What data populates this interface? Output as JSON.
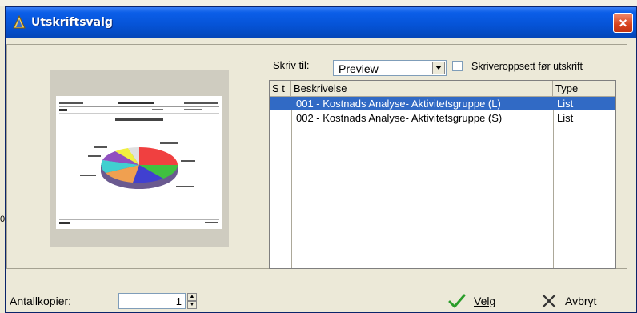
{
  "window": {
    "title": "Utskriftsvalg",
    "close_label": "×"
  },
  "background": {
    "stray_text": "0"
  },
  "print_to": {
    "label": "Skriv til:",
    "selected": "Preview"
  },
  "printer_setup": {
    "label": "Skriveroppsett før utskrift",
    "checked": false
  },
  "report_list": {
    "columns": [
      "S t",
      "Beskrivelse",
      "Type"
    ],
    "rows": [
      {
        "status": "",
        "description": "001 - Kostnads Analyse- Aktivitetsgruppe (L)",
        "type": "List",
        "selected": true
      },
      {
        "status": "",
        "description": "002 - Kostnads Analyse- Aktivitetsgruppe (S)",
        "type": "List",
        "selected": false
      }
    ]
  },
  "copies": {
    "label": "Antallkopier:",
    "value": "1"
  },
  "actions": {
    "select_label": "Velg",
    "cancel_label": "Avbryt"
  },
  "colors": {
    "titlebar": "#0553d6",
    "selection": "#316ac5",
    "select_icon": "#2a9d2a",
    "cancel_icon": "#333333"
  }
}
